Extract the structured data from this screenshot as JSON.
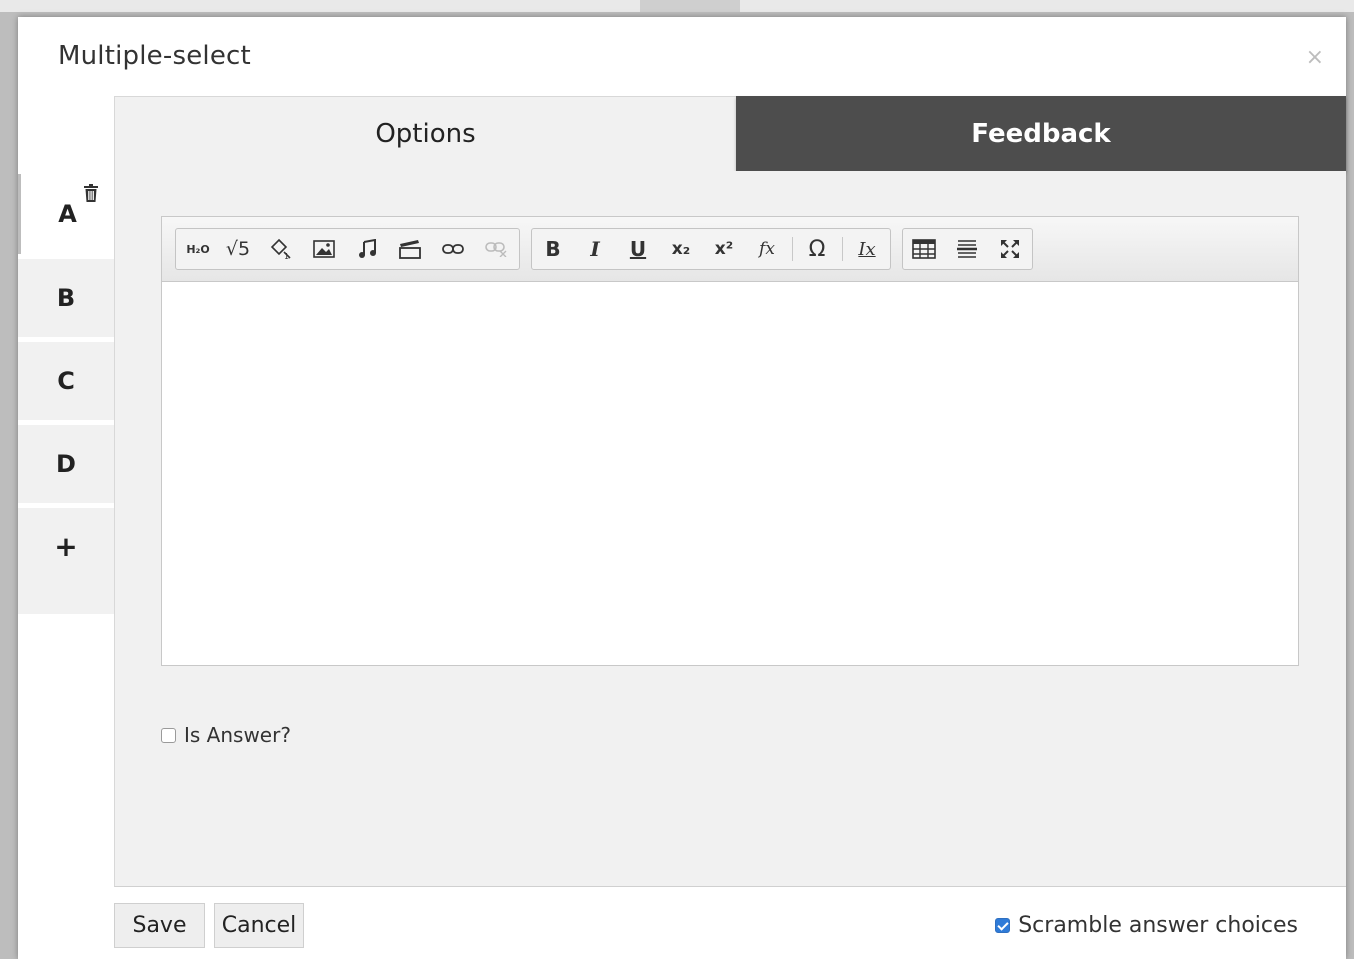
{
  "modal": {
    "title": "Multiple-select",
    "close_glyph": "×"
  },
  "tabs": [
    {
      "label": "Options",
      "active": true
    },
    {
      "label": "Feedback",
      "active": false
    }
  ],
  "choices": [
    {
      "label": "A",
      "active": true
    },
    {
      "label": "B"
    },
    {
      "label": "C"
    },
    {
      "label": "D"
    }
  ],
  "add_choice_glyph": "+",
  "toolbar": {
    "chem": "H₂O",
    "sqrt": "√5",
    "bold": "B",
    "italic": "I",
    "underline": "U",
    "subscript": "x₂",
    "superscript": "x²",
    "formula": "fx",
    "omega": "Ω",
    "clear": "Ix"
  },
  "is_answer": {
    "label": "Is Answer?",
    "checked": false
  },
  "footer": {
    "save_label": "Save",
    "cancel_label": "Cancel",
    "scramble_label": "Scramble answer choices",
    "scramble_checked": true
  },
  "colors": {
    "accent": "#2f7bd8",
    "feedback_tab": "#4d4d4d",
    "panel": "#f1f1f1"
  }
}
